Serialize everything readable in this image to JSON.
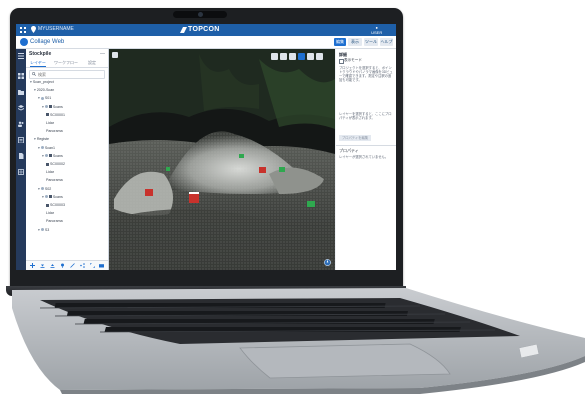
{
  "os_bar": {
    "workspace": "MYUSERNAME",
    "brand": "TOPCON",
    "user_line1": "USER",
    "user_line2": "MY ACCOUNT"
  },
  "app_bar": {
    "app_name": "Collage Web",
    "buttons": [
      "編集",
      "表示",
      "ツール",
      "ヘルプ"
    ]
  },
  "panel": {
    "title": "Stockpile",
    "collapse": "—",
    "tabs": [
      "レイヤー",
      "ワークフロー",
      "設定"
    ],
    "search_placeholder": "検索",
    "tree": [
      {
        "label": "Scan_project",
        "indent": 0
      },
      {
        "label": "2020-Scan",
        "indent": 1
      },
      {
        "label": "S01",
        "indent": 2
      },
      {
        "label": "Scans",
        "indent": 3
      },
      {
        "label": "SC00001",
        "indent": 4
      },
      {
        "label": "Lidar",
        "indent": 4
      },
      {
        "label": "Panorama",
        "indent": 4
      },
      {
        "label": "Registe",
        "indent": 1
      },
      {
        "label": "Scan1",
        "indent": 2
      },
      {
        "label": "Scans",
        "indent": 3
      },
      {
        "label": "SC00002",
        "indent": 4
      },
      {
        "label": "Lidar",
        "indent": 4
      },
      {
        "label": "Panorama",
        "indent": 4
      },
      {
        "label": "S02",
        "indent": 2
      },
      {
        "label": "Scans",
        "indent": 3
      },
      {
        "label": "SC00003",
        "indent": 4
      },
      {
        "label": "Lidar",
        "indent": 4
      },
      {
        "label": "Panorama",
        "indent": 4
      },
      {
        "label": "S3",
        "indent": 2
      }
    ]
  },
  "detail": {
    "heading": "詳細",
    "checkbox_label": "表示モード",
    "paragraph1": "プロジェクトを選択すると、ポイントクラウドやパノラマ画像を3Dビューで確認できます。測定や注釈の追加も可能です。",
    "paragraph2": "レイヤーを選択すると、ここにプロパティが表示されます。",
    "button_label": "プロパティを編集",
    "sub_heading": "プロパティ",
    "sub_text": "レイヤーが選択されていません。"
  },
  "colors": {
    "accent": "#1e5fa8",
    "rail": "#253a5c",
    "viewport_bg": "#151817",
    "marker_red": "#c8322c",
    "marker_green": "#2fa84f"
  }
}
